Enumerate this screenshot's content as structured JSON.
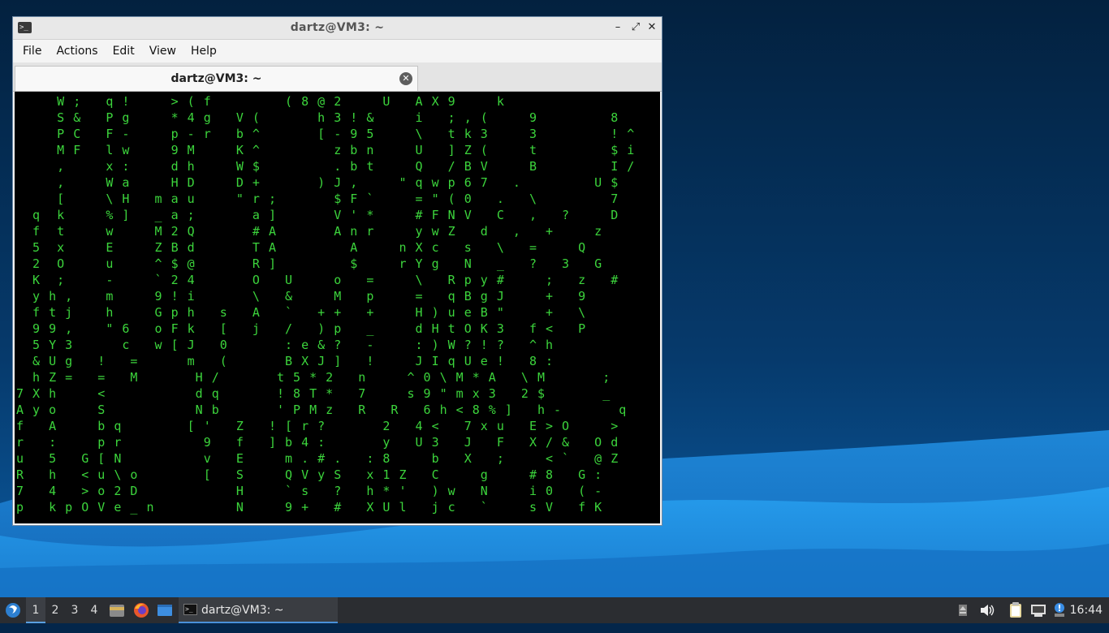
{
  "window": {
    "title": "dartz@VM3: ~",
    "menu": [
      "File",
      "Actions",
      "Edit",
      "View",
      "Help"
    ],
    "tab_label": "dartz@VM3: ~",
    "controls": {
      "minimize": "–",
      "maximize": "⤢",
      "close": "✕"
    },
    "terminal_text": "     W ;   q !     > ( f         ( 8 @ 2     U   A X 9     k\n     S &   P g     * 4 g   V (       h 3 ! &     i   ; , (     9         8\n     P C   F -     p - r   b ^       [ - 9 5     \\   t k 3     3         ! ^\n     M F   l w     9 M     K ^         z b n     U   ] Z (     t         $ i\n     ,     x :     d h     W $         . b t     Q   / B V     B         I /\n     ,     W a     H D     D +       ) J ,     \" q w p 6 7   .         U $\n     [     \\ H   m a u     \" r ;       $ F `     = \" ( 0   .   \\         7\n  q  k     % ]   _ a ;       a ]       V ' *     # F N V   C   ,   ?     D\n  f  t     w     M 2 Q       # A       A n r     y w Z   d   ,   +     z\n  5  x     E     Z B d       T A         A     n X c   s   \\   =     Q\n  2  O     u     ^ $ @       R ]         $     r Y g   N   _   ?   3   G\n  K  ;     -     ` 2 4       O   U     o   =     \\   R p y #     ;   z   #\n  y h ,    m     9 ! i       \\   &     M   p     =   q B g J     +   9\n  f t j    h     G p h   s   A   `   + +   +     H ) u e B \"     +   \\\n  9 9 ,    \" 6   o F k   [   j   /   ) p   _     d H t O K 3   f <   P\n  5 Y 3      c   w [ J   0       : e & ?   -     : ) W ? ! ?   ^ h\n  & U g   !   =      m   (       B X J ]   !     J I q U e !   8 :\n  h Z =   =   M       H /       t 5 * 2   n     ^ 0 \\ M * A   \\ M       ;\n7 X h     <           d q       ! 8 T *   7     s 9 \" m x 3   2 $       _\nA y o     S           N b       ' P M z   R   R   6 h < 8 % ]   h -       q\nf   A     b q        [ '   Z   ! [ r ?       2   4 <   7 x u   E > O     >\nr   :     p r          9   f   ] b 4 :       y   U 3   J   F   X / &   O d\nu   5   G [ N          v   E     m . # .   : 8     b   X   ;     < `   @ Z\nR   h   < u \\ o        [   S     Q V y S   x 1 Z   C     g     # 8   G :\n7   4   > o 2 D            H     ` s   ?   h * '   ) w   N     i 0   ( -\np   k p O V e _ n          N     9 +   #   X U l   j c   `     s V   f K"
  },
  "taskbar": {
    "workspaces": [
      "1",
      "2",
      "3",
      "4"
    ],
    "task_label": "dartz@VM3: ~",
    "clock": "16:44"
  },
  "icons": {
    "start": "lxqt-start-icon",
    "files": "file-manager-icon",
    "browser": "firefox-icon",
    "desktop": "show-desktop-icon",
    "eject": "eject-icon",
    "volume": "volume-icon",
    "clipboard": "clipboard-icon",
    "network": "network-icon",
    "notification": "notification-icon"
  },
  "colors": {
    "terminal_fg": "#3cd43c",
    "terminal_bg": "#000000",
    "desktop_bg": "#04264a",
    "wave": "#1b8fe6",
    "taskbar": "#2b2d31"
  }
}
